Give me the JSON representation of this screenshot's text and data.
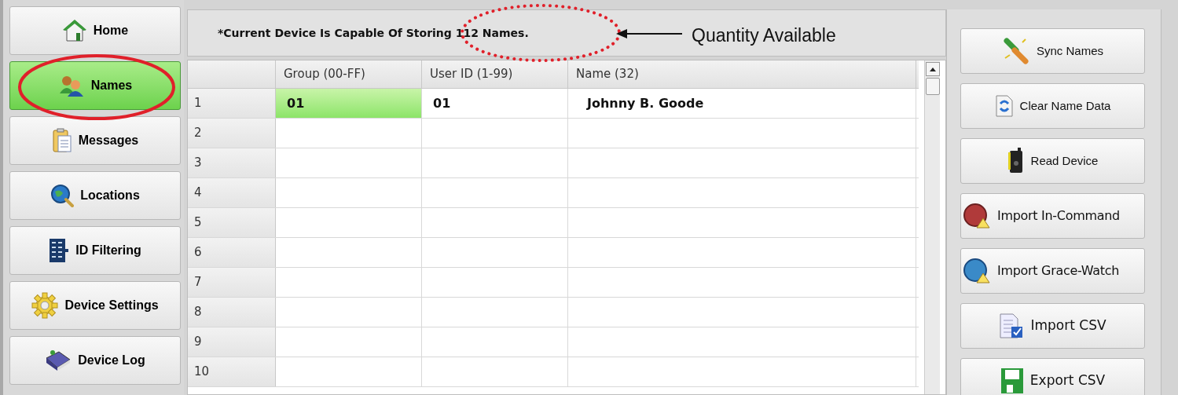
{
  "nav": [
    {
      "label": "Home",
      "selected": false
    },
    {
      "label": "Names",
      "selected": true
    },
    {
      "label": "Messages",
      "selected": false
    },
    {
      "label": "Locations",
      "selected": false
    },
    {
      "label": "ID Filtering",
      "selected": false
    },
    {
      "label": "Device Settings",
      "selected": false
    },
    {
      "label": "Device Log",
      "selected": false
    }
  ],
  "notice": "*Current Device Is Capable Of Storing 112 Names.",
  "annotation": "Quantity Available",
  "table": {
    "columns": [
      "Group (00-FF)",
      "User ID (1-99)",
      "Name (32)"
    ],
    "rows": [
      {
        "number": "1",
        "cells": [
          "01",
          "01",
          "Johnny B. Goode"
        ],
        "selected": true
      },
      {
        "number": "2",
        "selected": false
      },
      {
        "number": "3",
        "selected": false
      },
      {
        "number": "4",
        "selected": false
      },
      {
        "number": "5",
        "selected": false
      },
      {
        "number": "6",
        "selected": false
      },
      {
        "number": "7",
        "selected": false
      },
      {
        "number": "8",
        "selected": false
      },
      {
        "number": "9",
        "selected": false
      },
      {
        "number": "10",
        "selected": false
      }
    ]
  },
  "actions": [
    {
      "label": "Sync Names",
      "kind": "compact"
    },
    {
      "label": "Clear Name Data",
      "kind": "compact"
    },
    {
      "label": "Read Device",
      "kind": "compact"
    },
    {
      "label": "Import In-Command",
      "kind": "wide"
    },
    {
      "label": "Import Grace-Watch",
      "kind": "wide"
    },
    {
      "label": "Import CSV",
      "kind": "wide"
    },
    {
      "label": "Export CSV",
      "kind": "wide"
    }
  ]
}
